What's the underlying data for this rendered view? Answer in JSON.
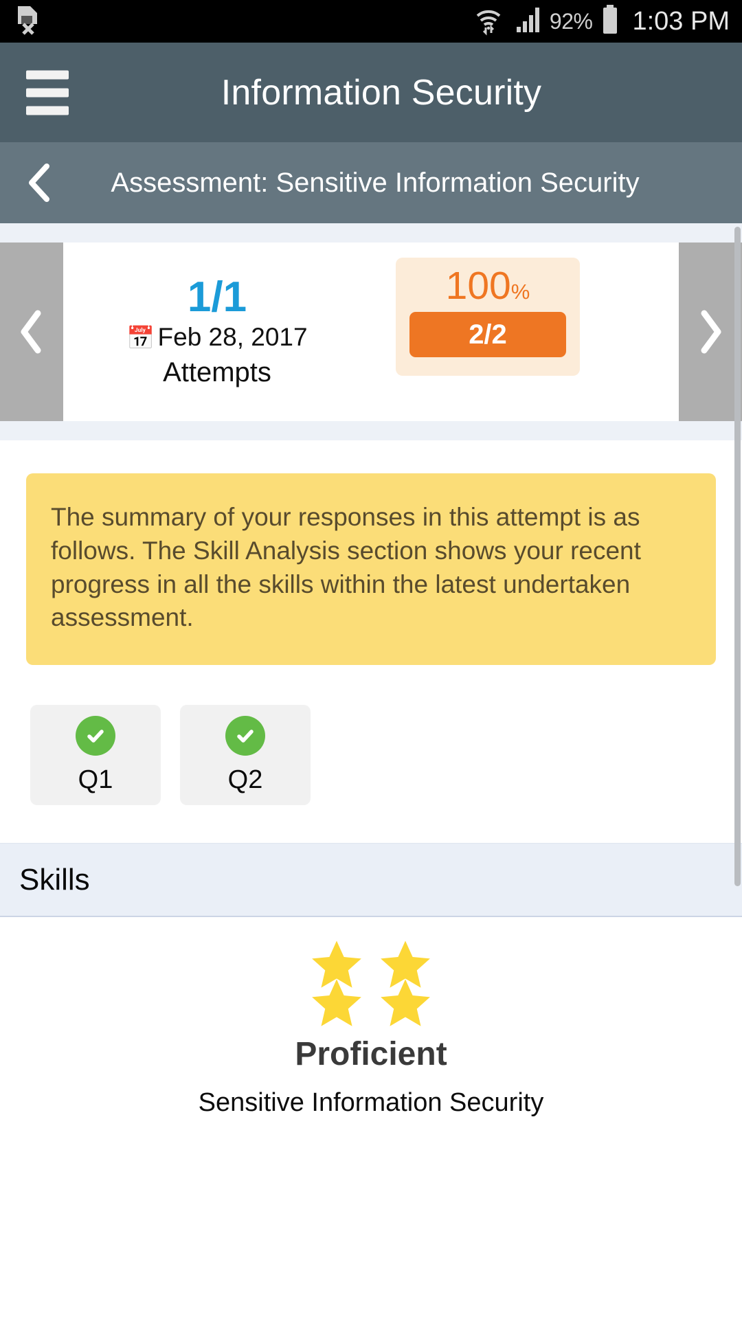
{
  "statusbar": {
    "sim_icon": "sim-card-error-icon",
    "wifi_icon": "wifi-transfer-icon",
    "signal_icon": "cellular-signal-icon",
    "battery_percent": "92%",
    "battery_icon": "battery-icon",
    "time": "1:03 PM"
  },
  "appbar": {
    "menu_icon": "hamburger-menu-icon",
    "title": "Information Security",
    "bg_color": "#4d5f69"
  },
  "subbar": {
    "back_icon": "chevron-left-icon",
    "title": "Assessment: Sensitive Information Security",
    "bg_color": "#657680"
  },
  "carousel": {
    "prev_icon": "chevron-left-icon",
    "next_icon": "chevron-right-icon",
    "attempt": {
      "fraction": "1/1",
      "calendar_icon": "calendar-icon",
      "date": "Feb 28, 2017",
      "label": "Attempts",
      "color": "#1b9bd8"
    },
    "score": {
      "percent": "100",
      "percent_symbol": "%",
      "ratio": "2/2",
      "panel_color": "#fcecd9",
      "accent_color": "#ee7623"
    }
  },
  "note": {
    "text": "The summary of your responses in this attempt is as follows. The Skill Analysis section shows your recent progress in all the skills within the latest undertaken assessment.",
    "bg_color": "#fbdd78",
    "text_color": "#584b2d"
  },
  "questions": [
    {
      "label": "Q1",
      "status_icon": "check-circle-icon",
      "status": "correct"
    },
    {
      "label": "Q2",
      "status_icon": "check-circle-icon",
      "status": "correct"
    }
  ],
  "skills_section": {
    "heading": "Skills",
    "bg_color": "#eaeff7"
  },
  "skill_card": {
    "stars_filled": 4,
    "star_icon": "star-icon",
    "star_color": "#fcd736",
    "level": "Proficient",
    "name": "Sensitive Information Security"
  }
}
